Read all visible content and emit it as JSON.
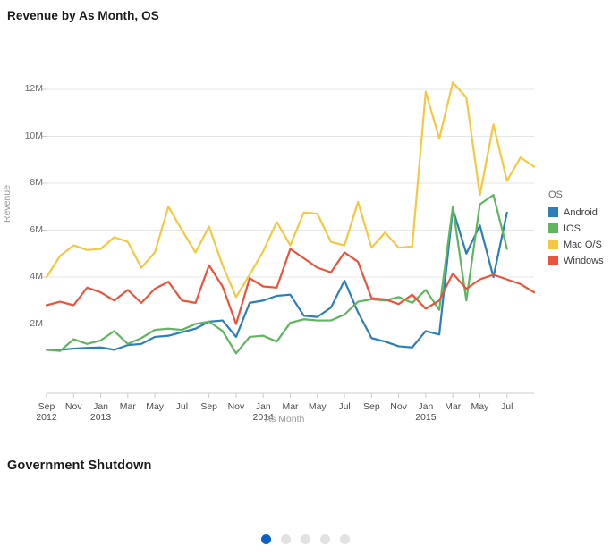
{
  "panels": {
    "chart_title": "Revenue by As Month, OS",
    "shutdown_title": "Government Shutdown"
  },
  "legend": {
    "title": "OS",
    "items": [
      {
        "label": "Android",
        "color": "#2c7fb8"
      },
      {
        "label": "IOS",
        "color": "#5fb65f"
      },
      {
        "label": "Mac O/S",
        "color": "#f5c842"
      },
      {
        "label": "Windows",
        "color": "#e8553c"
      }
    ]
  },
  "carousel": {
    "count": 5,
    "active_index": 0,
    "active_color": "#0b62c4",
    "inactive_color": "#e2e2e2"
  },
  "chart_data": {
    "type": "line",
    "title": "Revenue by As Month, OS",
    "xlabel": "As Month",
    "ylabel": "Revenue",
    "ylim": [
      0,
      12800000
    ],
    "yticks": [
      2000000,
      4000000,
      6000000,
      8000000,
      10000000,
      12000000
    ],
    "ytick_labels": [
      "2M",
      "4M",
      "6M",
      "8M",
      "10M",
      "12M"
    ],
    "grid": "horizontal",
    "legend_position": "right",
    "x": [
      "Sep 2012",
      "Oct 2012",
      "Nov 2012",
      "Dec 2012",
      "Jan 2013",
      "Feb 2013",
      "Mar 2013",
      "Apr 2013",
      "May 2013",
      "Jun 2013",
      "Jul 2013",
      "Aug 2013",
      "Sep 2013",
      "Oct 2013",
      "Nov 2013",
      "Dec 2013",
      "Jan 2014",
      "Feb 2014",
      "Mar 2014",
      "Apr 2014",
      "May 2014",
      "Jun 2014",
      "Jul 2014",
      "Aug 2014",
      "Sep 2014",
      "Oct 2014",
      "Nov 2014",
      "Dec 2014",
      "Jan 2015",
      "Feb 2015",
      "Mar 2015",
      "Apr 2015",
      "May 2015",
      "Jun 2015",
      "Jul 2015"
    ],
    "xtick_labels": [
      {
        "month": "Sep",
        "year": "2012"
      },
      {
        "month": "Nov",
        "year": ""
      },
      {
        "month": "Jan",
        "year": "2013"
      },
      {
        "month": "Mar",
        "year": ""
      },
      {
        "month": "May",
        "year": ""
      },
      {
        "month": "Jul",
        "year": ""
      },
      {
        "month": "Sep",
        "year": ""
      },
      {
        "month": "Nov",
        "year": ""
      },
      {
        "month": "Jan",
        "year": "2014"
      },
      {
        "month": "Mar",
        "year": ""
      },
      {
        "month": "May",
        "year": ""
      },
      {
        "month": "Jul",
        "year": ""
      },
      {
        "month": "Sep",
        "year": ""
      },
      {
        "month": "Nov",
        "year": ""
      },
      {
        "month": "Jan",
        "year": "2015"
      },
      {
        "month": "Mar",
        "year": ""
      },
      {
        "month": "May",
        "year": ""
      },
      {
        "month": "Jul",
        "year": ""
      }
    ],
    "series": [
      {
        "name": "Android",
        "color": "#2c7fb8",
        "values": [
          900000,
          900000,
          950000,
          980000,
          1000000,
          900000,
          1100000,
          1150000,
          1450000,
          1500000,
          1650000,
          1800000,
          2100000,
          2150000,
          1450000,
          2900000,
          3000000,
          3200000,
          3250000,
          2350000,
          2300000,
          2700000,
          3850000,
          2500000,
          1400000,
          1250000,
          1050000,
          1000000,
          1700000,
          1550000,
          6900000,
          5000000,
          6200000,
          4000000,
          6750000
        ]
      },
      {
        "name": "IOS",
        "color": "#5fb65f",
        "values": [
          900000,
          850000,
          1350000,
          1150000,
          1300000,
          1700000,
          1150000,
          1400000,
          1750000,
          1800000,
          1750000,
          2000000,
          2100000,
          1700000,
          750000,
          1450000,
          1500000,
          1250000,
          2050000,
          2200000,
          2150000,
          2150000,
          2400000,
          2950000,
          3050000,
          3000000,
          3150000,
          2900000,
          3450000,
          2600000,
          7000000,
          3000000,
          7100000,
          7500000,
          5200000
        ]
      },
      {
        "name": "Mac O/S",
        "color": "#f5c842",
        "values": [
          4000000,
          4900000,
          5350000,
          5150000,
          5200000,
          5700000,
          5500000,
          4400000,
          5050000,
          7000000,
          6000000,
          5050000,
          6150000,
          4500000,
          3150000,
          4100000,
          5100000,
          6350000,
          5350000,
          6750000,
          6700000,
          5500000,
          5350000,
          7200000,
          5250000,
          5900000,
          5250000,
          5300000,
          11900000,
          9900000,
          12300000,
          11650000,
          7500000,
          10500000,
          8100000,
          9100000,
          8700000
        ]
      },
      {
        "name": "Windows",
        "color": "#e8553c",
        "values": [
          2800000,
          2950000,
          2800000,
          3550000,
          3350000,
          3000000,
          3450000,
          2900000,
          3500000,
          3800000,
          3000000,
          2900000,
          4500000,
          3600000,
          2000000,
          3950000,
          3600000,
          3550000,
          5200000,
          4800000,
          4400000,
          4200000,
          5050000,
          4650000,
          3100000,
          3050000,
          2850000,
          3250000,
          2650000,
          3000000,
          4150000,
          3500000,
          3900000,
          4100000,
          3900000,
          3700000,
          3350000
        ]
      }
    ]
  }
}
